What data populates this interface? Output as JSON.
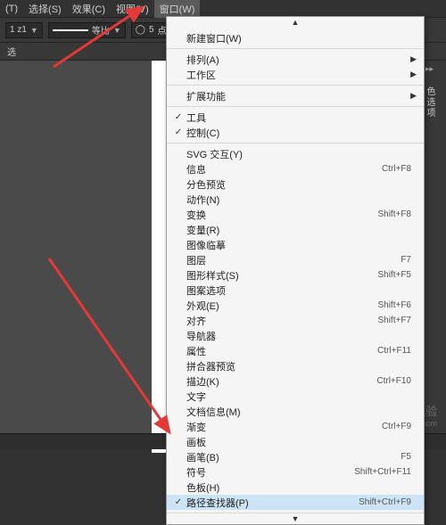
{
  "menubar": {
    "items": [
      {
        "label": "(T)"
      },
      {
        "label": "选择(S)"
      },
      {
        "label": "效果(C)"
      },
      {
        "label": "视图(V)"
      },
      {
        "label": "窗口(W)"
      }
    ]
  },
  "toolbar": {
    "brush_preset": "1 z1",
    "scale_label": "等比",
    "shape_sides": "5",
    "shape_label": "点圆形"
  },
  "second_row": {
    "label": "选"
  },
  "right_panel": {
    "swatch": "色选项"
  },
  "dropdown": {
    "sections": [
      {
        "items": [
          {
            "label": "新建窗口(W)"
          }
        ]
      },
      {
        "items": [
          {
            "label": "排列(A)",
            "sub": true
          },
          {
            "label": "工作区",
            "sub": true
          }
        ]
      },
      {
        "items": [
          {
            "label": "扩展功能",
            "sub": true
          }
        ]
      },
      {
        "items": [
          {
            "label": "工具",
            "check": true
          },
          {
            "label": "控制(C)",
            "check": true
          }
        ]
      },
      {
        "items": [
          {
            "label": "SVG 交互(Y)"
          },
          {
            "label": "信息",
            "shortcut": "Ctrl+F8"
          },
          {
            "label": "分色预览"
          },
          {
            "label": "动作(N)"
          },
          {
            "label": "变换",
            "shortcut": "Shift+F8"
          },
          {
            "label": "变量(R)"
          },
          {
            "label": "图像临摹"
          },
          {
            "label": "图层",
            "shortcut": "F7"
          },
          {
            "label": "图形样式(S)",
            "shortcut": "Shift+F5"
          },
          {
            "label": "图案选项"
          },
          {
            "label": "外观(E)",
            "shortcut": "Shift+F6"
          },
          {
            "label": "对齐",
            "shortcut": "Shift+F7"
          },
          {
            "label": "导航器"
          },
          {
            "label": "属性",
            "shortcut": "Ctrl+F11"
          },
          {
            "label": "拼合器预览"
          },
          {
            "label": "描边(K)",
            "shortcut": "Ctrl+F10"
          },
          {
            "label": "文字"
          },
          {
            "label": "文档信息(M)"
          },
          {
            "label": "渐变",
            "shortcut": "Ctrl+F9"
          },
          {
            "label": "画板"
          },
          {
            "label": "画笔(B)",
            "shortcut": "F5"
          },
          {
            "label": "符号",
            "shortcut": "Shift+Ctrl+F11"
          },
          {
            "label": "色板(H)"
          },
          {
            "label": "路径查找器(P)",
            "selected": true,
            "check": true,
            "shortcut": "Shift+Ctrl+F9"
          }
        ]
      }
    ]
  },
  "status": {
    "label": "  "
  },
  "watermark": {
    "main": "Baidu 经验",
    "sub": "jingyan.baidu.com"
  }
}
